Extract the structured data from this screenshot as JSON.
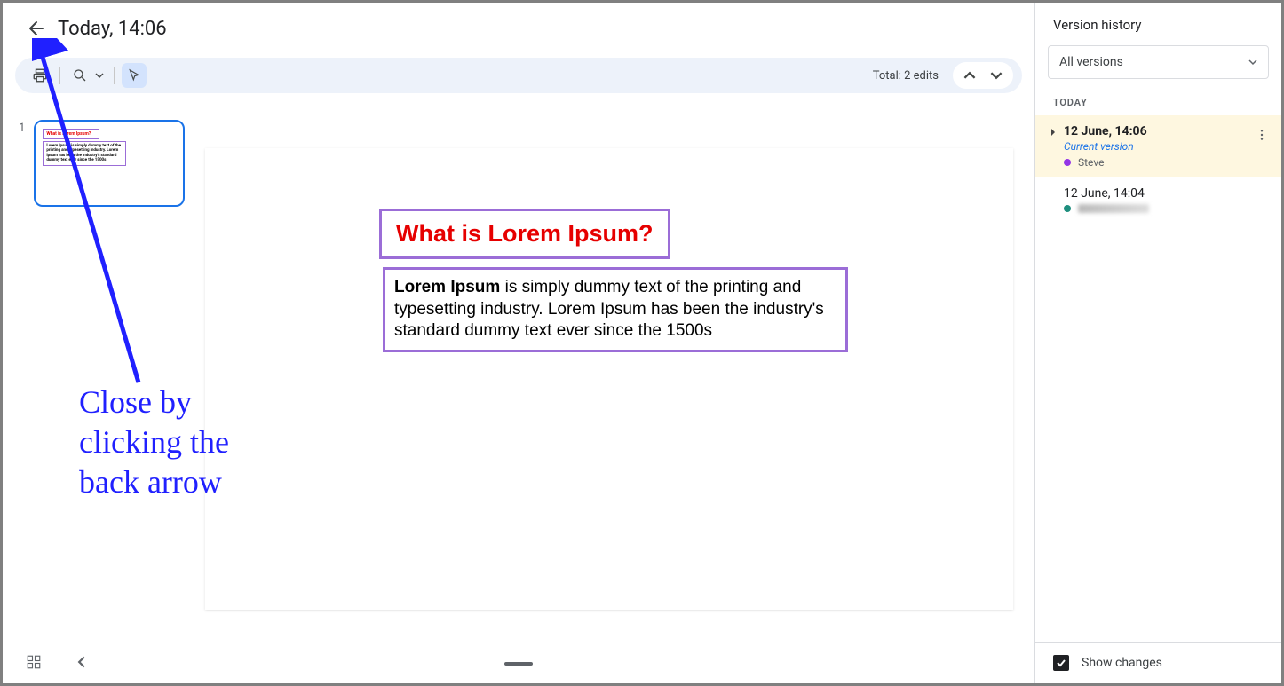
{
  "header": {
    "title": "Today, 14:06"
  },
  "toolbar": {
    "edits_total": "Total: 2 edits"
  },
  "thumbnails": [
    {
      "num": "1",
      "mini_title": "What is Lorem Ipsum?",
      "mini_body": "Lorem Ipsum is simply dummy text of the printing and typesetting industry. Lorem Ipsum has been the industry's standard dummy text ever since the 1500s"
    }
  ],
  "slide": {
    "title": "What is Lorem Ipsum?",
    "body_bold": "Lorem Ipsum",
    "body_rest": " is simply dummy text of the printing and typesetting industry. Lorem Ipsum has been the industry's standard dummy text ever since the 1500s"
  },
  "annotation": {
    "text": "Close by\nclicking the\nback arrow"
  },
  "sidebar": {
    "title": "Version history",
    "dropdown": "All versions",
    "section": "TODAY",
    "show_changes": "Show changes",
    "versions": [
      {
        "time": "12 June, 14:06",
        "subtitle": "Current version",
        "authors": [
          {
            "color": "purple",
            "name": "Steve"
          }
        ],
        "current": true
      },
      {
        "time": "12 June, 14:04",
        "authors": [
          {
            "color": "teal",
            "blurred": true
          }
        ],
        "current": false
      }
    ]
  }
}
